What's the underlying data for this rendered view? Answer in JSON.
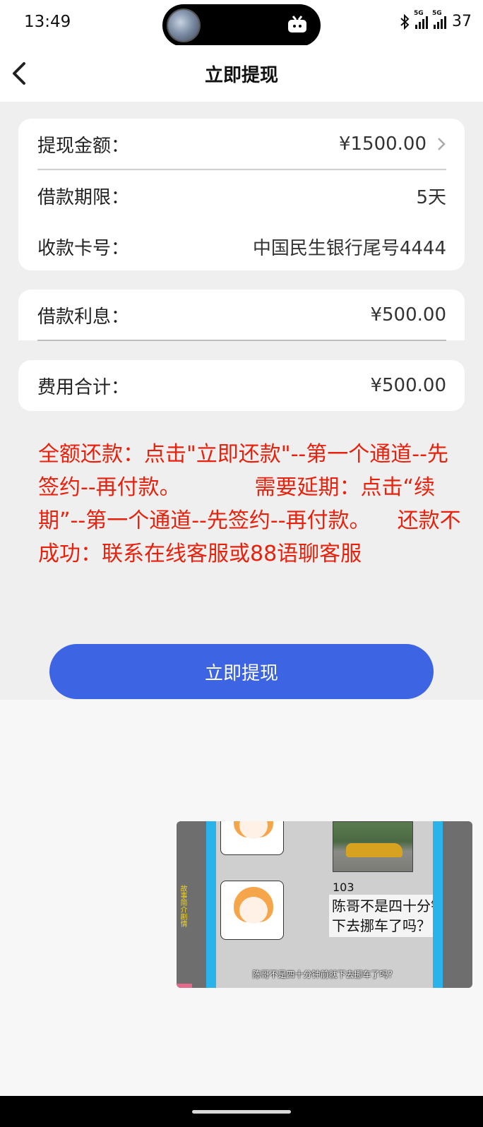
{
  "status_bar": {
    "time": "13:49",
    "signal1_label": "5G",
    "signal2_label": "5G",
    "battery": "37"
  },
  "header": {
    "title": "立即提现"
  },
  "loan_card": {
    "amount_label": "提现金额：",
    "amount_value": "¥1500.00",
    "term_label": "借款期限：",
    "term_value": "5天",
    "card_label": "收款卡号：",
    "card_value": "中国民生银行尾号4444"
  },
  "interest_card": {
    "label": "借款利息：",
    "value": "¥500.00"
  },
  "fee_card": {
    "label": "费用合计：",
    "value": "¥500.00"
  },
  "notice": "全额还款：点击\"立即还款\"--第一个通道--先签约--再付款。           需要延期：点击“续期”--第一个通道--先签约--再付款。    还款不成功：联系在线客服或88语聊客服",
  "submit_button": "立即提现",
  "video_overlay": {
    "side_text": "故事简介剧情",
    "number": "103",
    "bubble": "陈哥不是四十分钟前就下去挪车了吗？",
    "caption": "陈哥不是四十分钟前就下去挪车了吗？"
  },
  "colors": {
    "accent": "#3d64e3",
    "notice": "#e8210c",
    "page_bg": "#efefef"
  }
}
